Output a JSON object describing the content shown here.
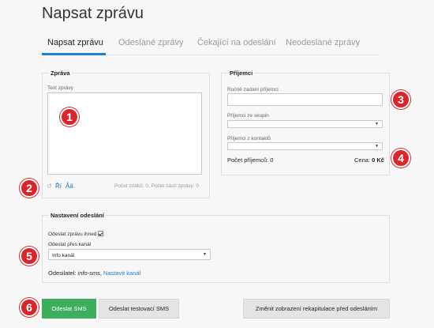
{
  "page": {
    "title": "Napsat zprávu"
  },
  "tabs": [
    {
      "label": "Napsat zprávu",
      "active": true
    },
    {
      "label": "Odeslané zprávy",
      "active": false
    },
    {
      "label": "Čekající na odeslání",
      "active": false
    },
    {
      "label": "Neodeslané zprávy",
      "active": false
    }
  ],
  "message": {
    "legend": "Zpráva",
    "text_label": "Text zprávy",
    "text_value": "",
    "counter": "Počet znaků: 0, Počet částí zprávy: 0",
    "tools": {
      "undo": "↺",
      "ri": "Ří",
      "aa": "Åä"
    }
  },
  "recipients": {
    "legend": "Příjemci",
    "manual_label": "Ručně zadaní příjemci",
    "manual_value": "",
    "groups_label": "Příjemci ze skupin",
    "groups_value": "",
    "contacts_label": "Příjemci z kontaktů",
    "contacts_value": "",
    "count_text": "Počet příjemců: 0",
    "price_label": "Cena: ",
    "price_value": "0 Kč"
  },
  "settings": {
    "legend": "Nastavení odeslání",
    "send_now_label": "Odeslat zprávu ihned",
    "send_now_checked": true,
    "channel_label": "Odeslat přes kanál",
    "channel_value": "Info kanál",
    "sender_label": "Odesilatel: ",
    "sender_value": "info-sms",
    "sender_separator": ", ",
    "sender_link": "Nastavit kanál"
  },
  "buttons": {
    "send": "Odeslat SMS",
    "send_test": "Odeslat testovací SMS",
    "toggle_summary": "Změnit zobrazení rekapitulace před odesláním"
  },
  "badges": [
    "1",
    "2",
    "3",
    "4",
    "5",
    "6"
  ],
  "colors": {
    "accent": "#1f7fd1",
    "send_button": "#3dae5c",
    "badge": "#d8272c"
  }
}
